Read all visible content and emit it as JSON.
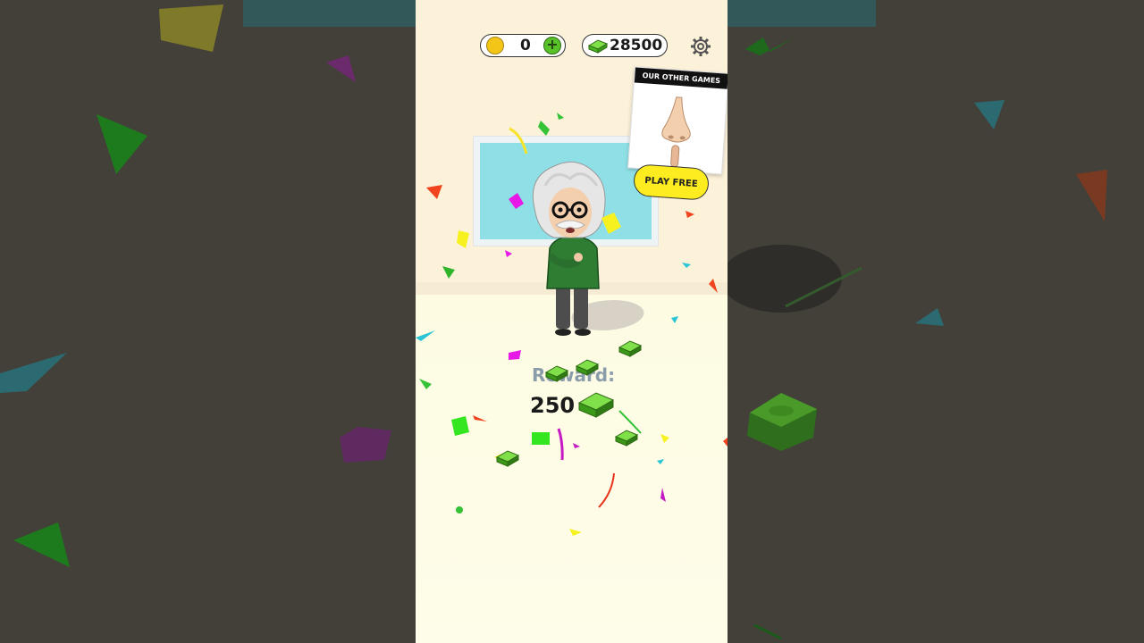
{
  "hud": {
    "hints_count": "0",
    "cash_count": "28500",
    "hint_icon": "key-icon",
    "add_icon": "plus-icon",
    "cash_icon": "cash-stack-icon",
    "settings_icon": "gear-icon"
  },
  "promo": {
    "header": "OUR OTHER GAMES",
    "button_label": "PLAY FREE",
    "image_icon": "nose-finger-icon"
  },
  "reward": {
    "label": "Reward:",
    "value": "250"
  },
  "colors": {
    "accent_yellow": "#fcec20",
    "plus_green": "#59c228",
    "cash_green": "#64d234",
    "shirt_green": "#2e7d32"
  }
}
